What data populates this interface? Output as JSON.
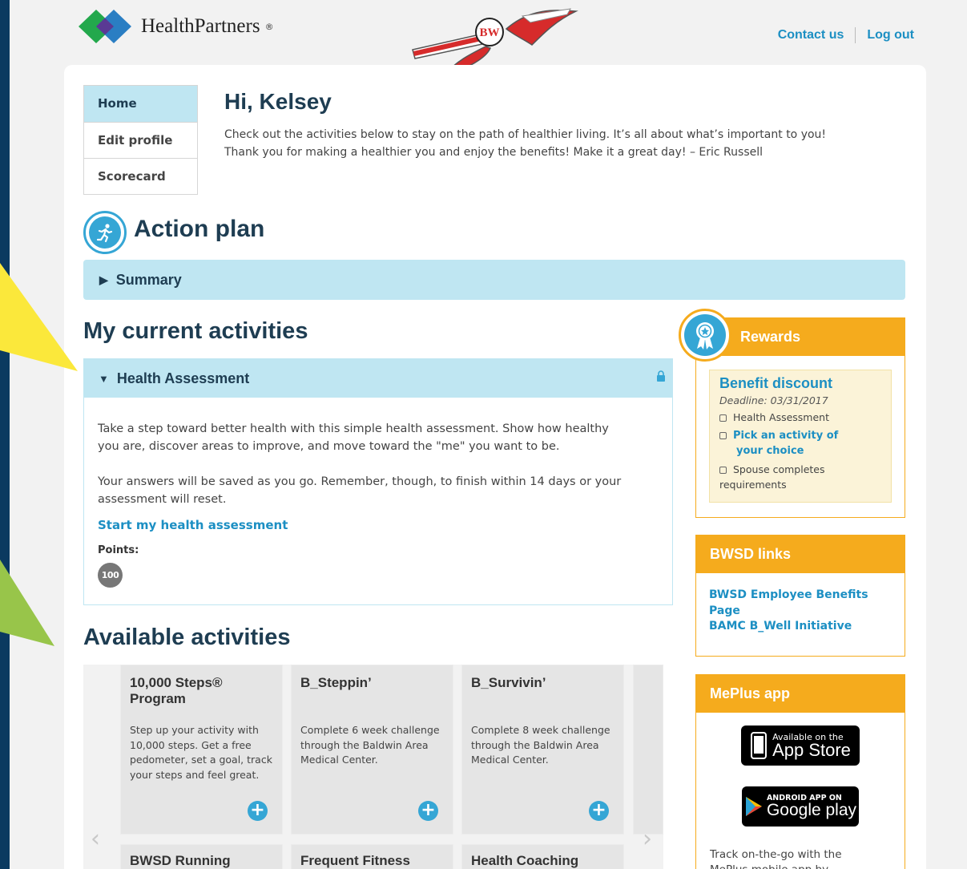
{
  "brand": {
    "name": "HealthPartners"
  },
  "header": {
    "contact_label": "Contact us",
    "logout_label": "Log out"
  },
  "nav": {
    "items": [
      "Home",
      "Edit profile",
      "Scorecard"
    ]
  },
  "greeting": {
    "title": "Hi, Kelsey",
    "line1": "Check out the activities below to stay on the path of healthier living. It’s all about what’s important to you!",
    "line2": "Thank you for making a healthier you and enjoy the benefits! Make it a great day! – Eric Russell"
  },
  "action_plan": {
    "title": "Action plan",
    "summary_label": "Summary"
  },
  "current": {
    "heading": "My current activities",
    "health_assessment": {
      "title": "Health Assessment",
      "para1_line1": "Take a step toward better health with this simple health assessment. Show how healthy",
      "para1_line2": "you are, discover areas to improve, and move toward the \"me\" you want to be.",
      "para2_line1": "Your answers will be saved as you go. Remember, though, to finish within 14 days or your",
      "para2_line2": "assessment will reset.",
      "link": "Start my health assessment",
      "points_label": "Points:",
      "points": "100"
    }
  },
  "available": {
    "heading": "Available activities",
    "tiles": [
      {
        "title": "10,000 Steps® Program",
        "desc": "Step up your activity with 10,000 steps. Get a free pedometer, set a goal, track your steps and feel great."
      },
      {
        "title": "B_Steppin’",
        "desc": "Complete 6 week challenge through the Baldwin Area Medical Center."
      },
      {
        "title": "B_Survivin’",
        "desc": "Complete 8 week challenge through the Baldwin Area Medical Center."
      },
      {
        "title": "BWSD Running"
      },
      {
        "title": "Frequent Fitness"
      },
      {
        "title": "Health Coaching"
      }
    ]
  },
  "rewards": {
    "title": "Rewards",
    "benefit_title": "Benefit discount",
    "deadline": "Deadline: 03/31/2017",
    "items": [
      "Health Assessment",
      "Pick an activity of",
      "your choice",
      "Spouse completes",
      "requirements"
    ]
  },
  "bwsd_links": {
    "title": "BWSD links",
    "links": [
      "BWSD Employee Benefits",
      "Page",
      "BAMC B_Well Initiative"
    ]
  },
  "meplus": {
    "title": "MePlus app",
    "appstore_top": "Available on the",
    "appstore_bottom": "App Store",
    "google_top": "ANDROID APP ON",
    "google_bottom": "Google play",
    "text": "Track on-the-go with the",
    "text2": "MePlus mobile app by"
  },
  "colors": {
    "accent_blue": "#1c8fc3",
    "light_blue": "#bfe6f2",
    "orange": "#f5ab1d",
    "navy": "#1e3d52",
    "frame": "#0b3a60"
  }
}
